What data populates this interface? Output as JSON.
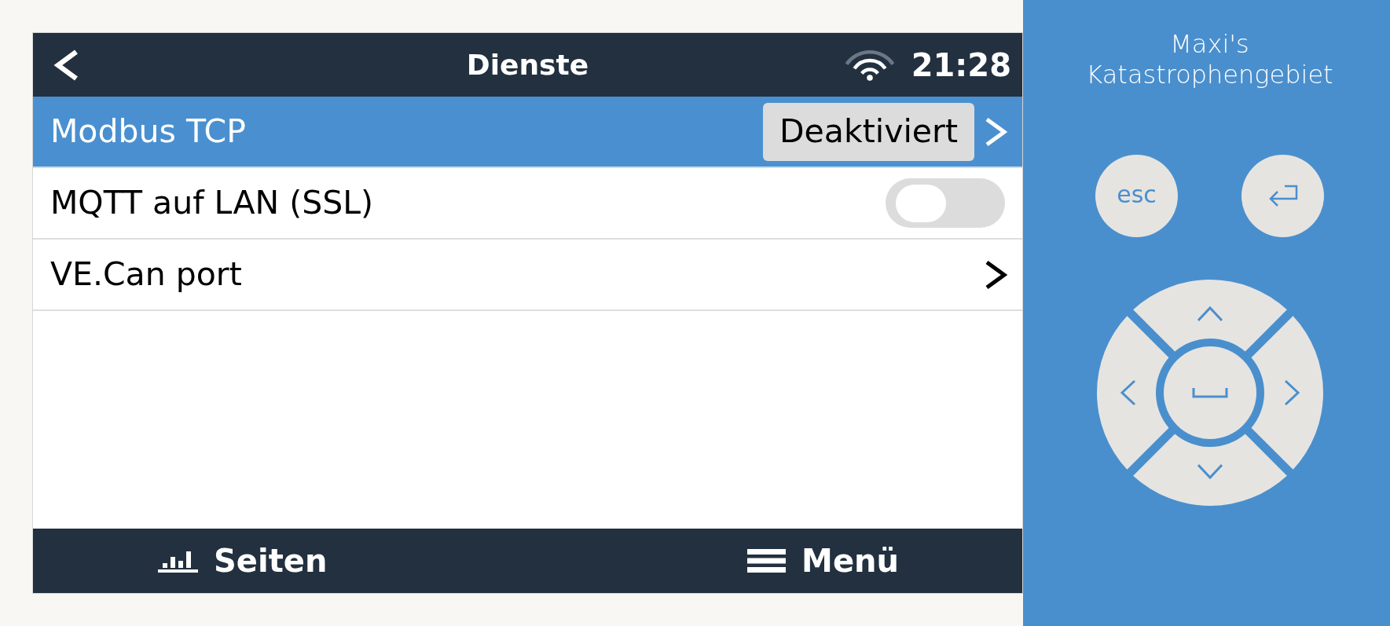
{
  "header": {
    "title": "Dienste",
    "time": "21:28"
  },
  "rows": [
    {
      "kind": "value",
      "label": "Modbus TCP",
      "value": "Deaktiviert",
      "selected": true
    },
    {
      "kind": "switch",
      "label": "MQTT auf LAN (SSL)",
      "on": false,
      "selected": false
    },
    {
      "kind": "link",
      "label": "VE.Can port",
      "selected": false
    }
  ],
  "footer": {
    "buttons": [
      {
        "kind": "pages",
        "label": "Seiten"
      },
      {
        "kind": "menu",
        "label": "Menü"
      }
    ]
  },
  "side_panel": {
    "title": "Maxi's Katastrophengebiet",
    "esc_key": "esc"
  }
}
